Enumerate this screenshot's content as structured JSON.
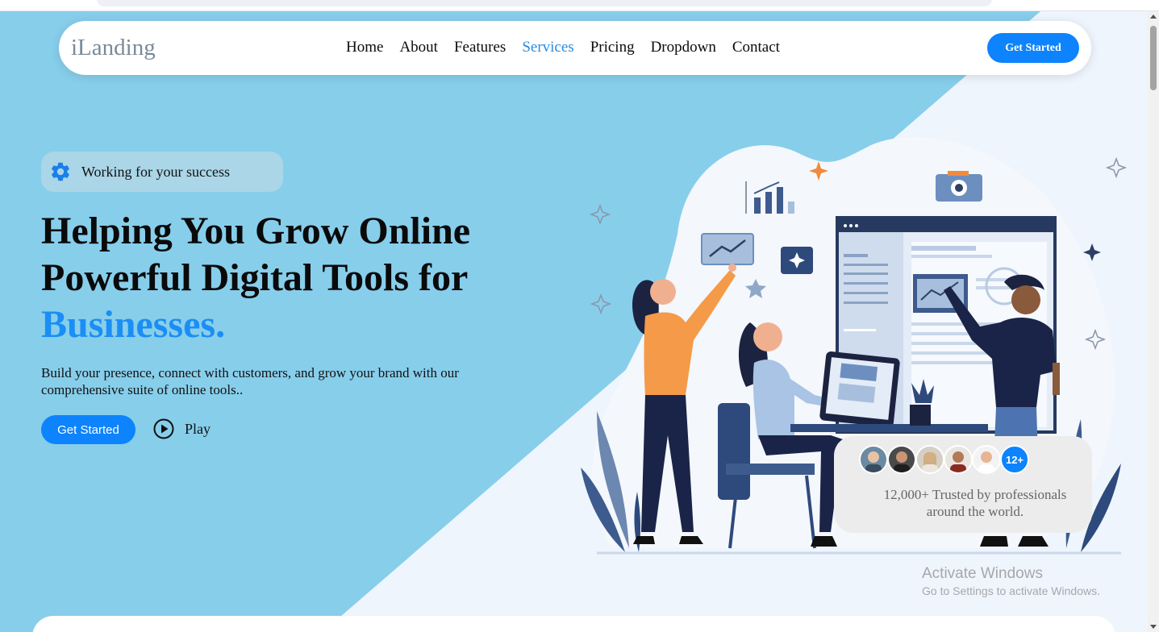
{
  "brand": {
    "logo": "iLanding",
    "accent": "#0d83fd",
    "hero_bg": "#87ceeb"
  },
  "nav": {
    "items": [
      {
        "label": "Home",
        "active": false
      },
      {
        "label": "About",
        "active": false
      },
      {
        "label": "Features",
        "active": false
      },
      {
        "label": "Services",
        "active": true
      },
      {
        "label": "Pricing",
        "active": false
      },
      {
        "label": "Dropdown",
        "active": false
      },
      {
        "label": "Contact",
        "active": false
      }
    ],
    "cta": "Get Started"
  },
  "hero": {
    "badge": {
      "icon": "gear-icon",
      "text": "Working for your success"
    },
    "headline_line1": "Helping You Grow Online",
    "headline_line2": "Powerful Digital Tools for",
    "headline_accent": "Businesses.",
    "subtext": "Build your presence, connect with customers, and grow your brand with our comprehensive suite of online tools..",
    "cta": "Get Started",
    "play": {
      "icon": "play-circle-icon",
      "label": "Play"
    }
  },
  "trusted": {
    "more_count": "12+",
    "text": "12,000+ Trusted by professionals around the world."
  },
  "watermark": {
    "title": "Activate Windows",
    "subtitle": "Go to Settings to activate Windows."
  }
}
